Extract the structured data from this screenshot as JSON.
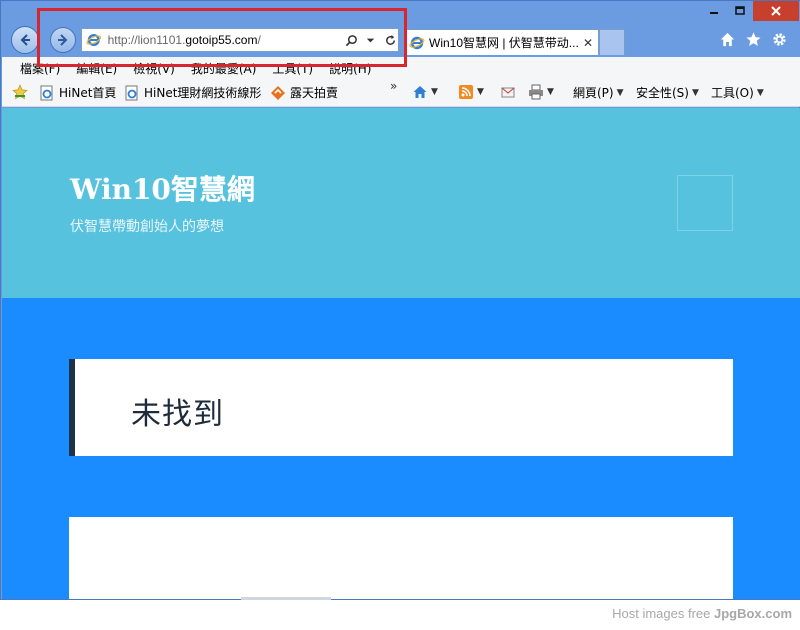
{
  "browser": {
    "address": {
      "url_prefix": "http://lion1101.",
      "url_domain": "gotoip55.com",
      "url_suffix": "/"
    },
    "tab": {
      "title": "Win10智慧网 | 伏智慧带动...",
      "close": "✕"
    },
    "menu": [
      "檔案(F)",
      "編輯(E)",
      "檢視(V)",
      "我的最愛(A)",
      "工具(T)",
      "說明(H)"
    ],
    "favorites": [
      "HiNet首頁",
      "HiNet理財網技術線形",
      "露天拍賣"
    ],
    "overflow_chevron": "»",
    "commands": {
      "page": "網頁(P)",
      "safety": "安全性(S)",
      "tools": "工具(O)"
    },
    "caret": "▼"
  },
  "site": {
    "title": "Win10智慧網",
    "tagline": "伏智慧帶動創始人的夢想",
    "not_found": "未找到"
  },
  "footer": {
    "text": "Host images free ",
    "brand": "JpgBox.com"
  },
  "colors": {
    "header": "#57c2de",
    "page_bg": "#1a8cff",
    "card_accent": "#1e3246",
    "highlight": "#d7262e"
  }
}
